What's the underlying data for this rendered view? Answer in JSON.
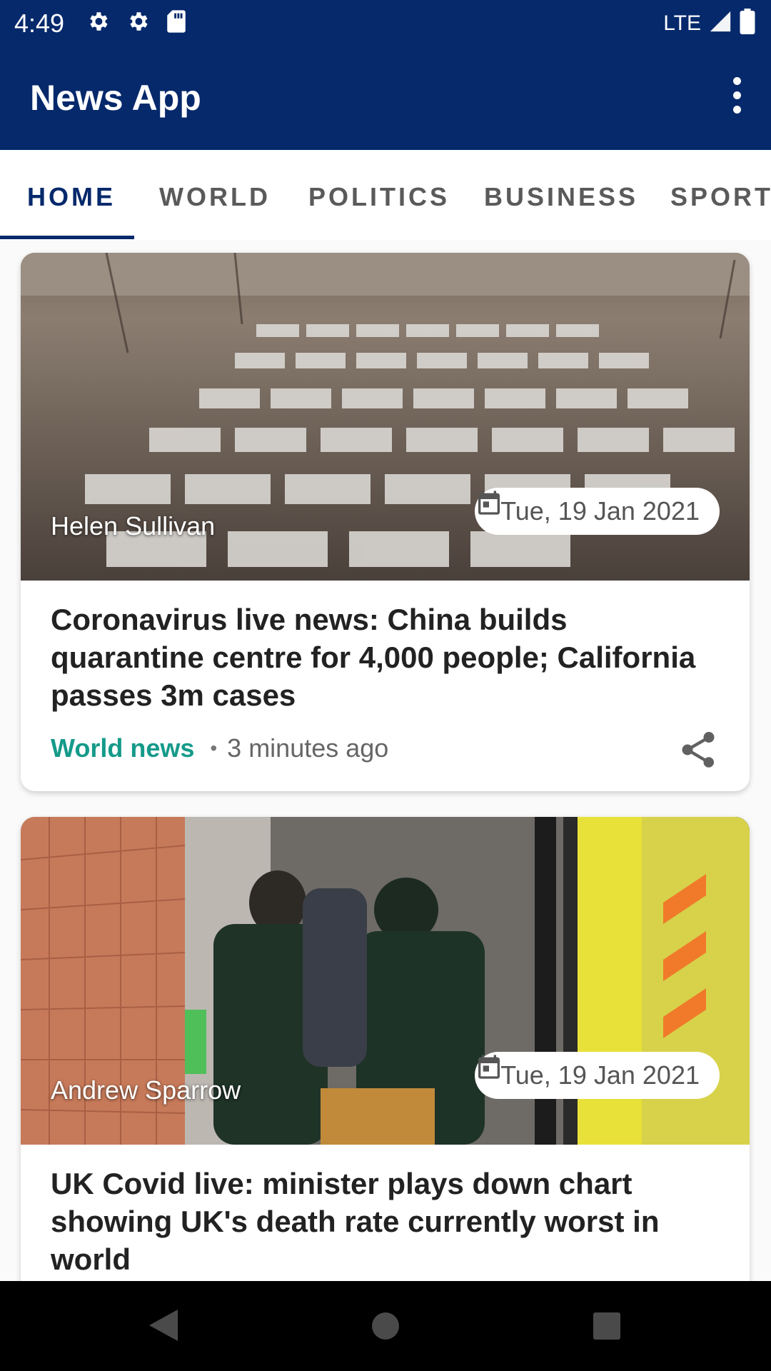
{
  "status_bar": {
    "time": "4:49",
    "network": "LTE",
    "left_icons": [
      "gear-icon",
      "gear-icon",
      "sd-card-icon"
    ],
    "right_icons": [
      "signal-icon",
      "battery-icon"
    ]
  },
  "app_bar": {
    "title": "News App",
    "overflow_icon": "more-vert-icon"
  },
  "tabs": [
    {
      "label": "HOME",
      "active": true
    },
    {
      "label": "WORLD",
      "active": false
    },
    {
      "label": "POLITICS",
      "active": false
    },
    {
      "label": "BUSINESS",
      "active": false
    },
    {
      "label": "SPORT",
      "active": false
    }
  ],
  "articles": [
    {
      "author": "Helen Sullivan",
      "date": "Tue, 19 Jan 2021",
      "headline": "Coronavirus live news: China builds quarantine centre for 4,000 people; California passes 3m cases",
      "category": "World news",
      "time_ago": "3 minutes ago"
    },
    {
      "author": "Andrew Sparrow",
      "date": "Tue, 19 Jan 2021",
      "headline": "UK Covid live: minister plays down chart showing UK's death rate currently worst in world"
    }
  ],
  "colors": {
    "primary": "#05296b",
    "accent": "#159a8a"
  },
  "nav_bar": [
    "back-icon",
    "home-icon",
    "recents-icon"
  ]
}
